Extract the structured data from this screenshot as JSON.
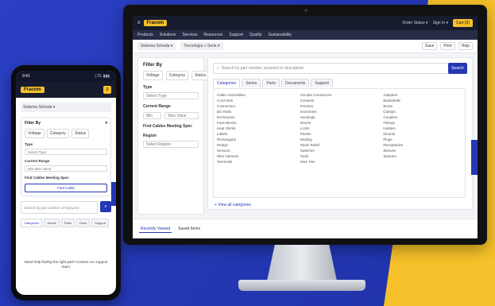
{
  "desktop": {
    "logo_mark": "≡",
    "logo": "Fracom",
    "top_links": [
      "Order Status  ▾",
      "Sign In  ▾"
    ],
    "top_button": "Cart (0)",
    "nav": [
      "Products",
      "Solutions",
      "Services",
      "Resources",
      "Support",
      "Quality",
      "Sustainability"
    ],
    "breadcrumbs": [
      "Sistema Scheda  ▾",
      "Tecnologia > Serie  ▾"
    ],
    "sub_buttons": [
      "Save",
      "Print",
      "Help"
    ],
    "sidebar": {
      "title": "Filter By",
      "pills": [
        "Voltage",
        "Category",
        "Status"
      ],
      "label1": "Type",
      "field1": "Select Type",
      "label2": "Current Range",
      "field2a": "Min",
      "field2b": "Max Value",
      "label3": "Find Cables Meeting Spec",
      "label4": "Region",
      "field4": "Select Region"
    },
    "search": {
      "placeholder": "Search by part number, keyword or description",
      "button": "Search"
    },
    "tabs": [
      "Categories",
      "Series",
      "Parts",
      "Documents",
      "Support"
    ],
    "results": [
      [
        "Cable Assemblies",
        "Cord Sets",
        "Connectors",
        "Din Rails",
        "Enclosures",
        "Fuse Blocks",
        "Heat Shrink",
        "Labels",
        "Rectangular",
        "Relays",
        "Sensors",
        "Wire Harness",
        "Terminals"
      ],
      [
        "Circular Connectors",
        "Contacts",
        "Ferrules",
        "Grommets",
        "Housings",
        "Inserts",
        "Locks",
        "Panels",
        "Sealing",
        "Strain Relief",
        "Switches",
        "Tools",
        "Wire Ties"
      ],
      [
        "Adapters",
        "Backshells",
        "Boots",
        "Clamps",
        "Couplers",
        "Fittings",
        "Holders",
        "Mounts",
        "Plugs",
        "Receptacles",
        "Sleeves",
        "Spacers"
      ]
    ],
    "more_link": "+ View all categories",
    "footer_tabs": [
      "Recently Viewed",
      "Saved Items"
    ]
  },
  "mobile": {
    "status_time": "9:41",
    "status_right": "LTE ▮▮▮",
    "logo": "Fracom",
    "menu_icon": "≡",
    "breadcrumb": "Sistema Scheda  ▾",
    "filter_title": "Filter By",
    "filter_caret": "▾",
    "pills": [
      "Voltage",
      "Category",
      "Status"
    ],
    "type_label": "Type",
    "type_field": "Select Type",
    "range_label": "Current Range",
    "range_field": "Min   Max Value",
    "spec_label": "Find Cables Meeting Spec",
    "find_button": "Find Cable",
    "search_placeholder": "Search by part number or keyword",
    "search_icon": "⌕",
    "tabs": [
      "Categories",
      "Series",
      "Parts",
      "Docs",
      "Support"
    ],
    "bottom_text": "Need help finding the right part? Contact our support team"
  }
}
